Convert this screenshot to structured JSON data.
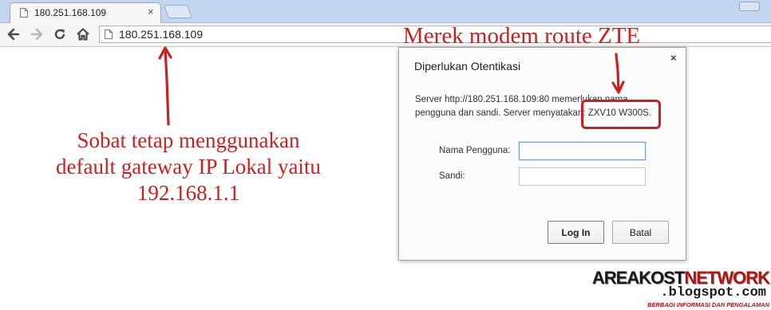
{
  "browser": {
    "tab_title": "180.251.168.109",
    "url": "180.251.168.109"
  },
  "dialog": {
    "title": "Diperlukan Otentikasi",
    "message": "Server http://180.251.168.109:80 memerlukan nama pengguna dan sandi. Server menyatakan: ZXV10 W300S.",
    "username_label": "Nama Pengguna:",
    "username_value": "",
    "password_label": "Sandi:",
    "password_value": "",
    "login_button": "Log In",
    "cancel_button": "Batal",
    "close_glyph": "×"
  },
  "annotations": {
    "left_line1": "Sobat tetap menggunakan",
    "left_line2": "default gateway IP Lokal yaitu",
    "left_line3": "192.168.1.1",
    "top_right": "Merek modem route ZTE",
    "color": "#cc1f1f"
  },
  "watermark": {
    "brand_part1": "AREAKOST",
    "brand_part2": "NETWORK",
    "site": ".blogspot.com",
    "tagline": "BERBAGI INFORMASI DAN PENGALAMAN"
  },
  "icons": {
    "back": "back-arrow-icon",
    "forward": "forward-arrow-icon",
    "reload": "reload-icon",
    "home": "home-icon",
    "page": "page-icon"
  }
}
